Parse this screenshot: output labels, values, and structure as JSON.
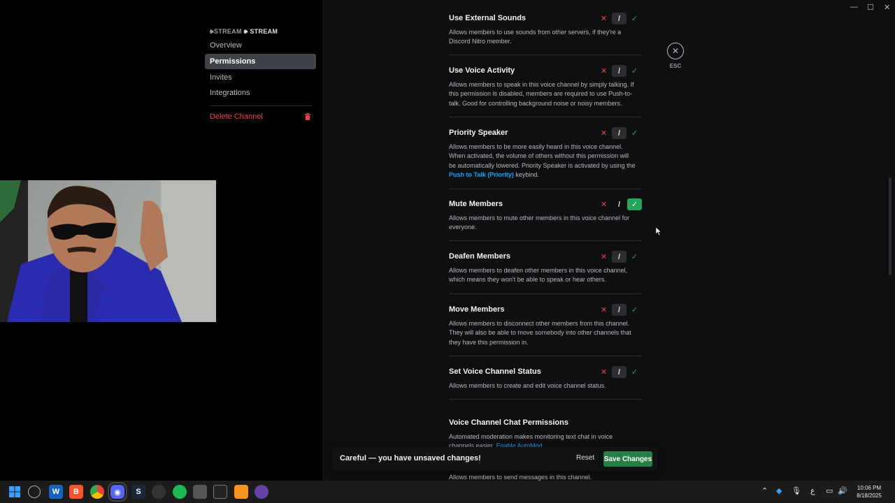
{
  "window": {
    "minimize_glyph": "—",
    "maximize_glyph": "☐",
    "close_glyph": "✕"
  },
  "sidebar": {
    "category_prefix": "🕪STREAM",
    "category_name": "🕪 STREAM",
    "items": [
      {
        "label": "Overview"
      },
      {
        "label": "Permissions"
      },
      {
        "label": "Invites"
      },
      {
        "label": "Integrations"
      }
    ],
    "delete_label": "Delete Channel"
  },
  "permissions": [
    {
      "title": "Use External Sounds",
      "desc": "Allows members to use sounds from other servers, if they're a Discord Nitro member.",
      "state": "neutral"
    },
    {
      "title": "Use Voice Activity",
      "desc": "Allows members to speak in this voice channel by simply talking. If this permission is disabled, members are required to use Push-to-talk. Good for controlling background noise or noisy members.",
      "state": "neutral"
    },
    {
      "title": "Priority Speaker",
      "desc_before": "Allows members to be more easily heard in this voice channel. When activated, the volume of others without this permission will be automatically lowered. Priority Speaker is activated by using the ",
      "desc_link": "Push to Talk (Priority)",
      "desc_after": " keybind.",
      "state": "neutral"
    },
    {
      "title": "Mute Members",
      "desc": "Allows members to mute other members in this voice channel for everyone.",
      "state": "allow"
    },
    {
      "title": "Deafen Members",
      "desc": "Allows members to deafen other members in this voice channel, which means they won't be able to speak or hear others.",
      "state": "neutral"
    },
    {
      "title": "Move Members",
      "desc": "Allows members to disconnect other members from this channel. They will also be able to move somebody into other channels that they have this permission in.",
      "state": "neutral"
    },
    {
      "title": "Set Voice Channel Status",
      "desc": "Allows members to create and edit voice channel status.",
      "state": "neutral"
    }
  ],
  "toggle_glyphs": {
    "deny": "✕",
    "neutral": "/",
    "allow": "✓"
  },
  "section": {
    "title": "Voice Channel Chat Permissions",
    "desc": "Automated moderation makes monitoring text chat in voice channels easier.",
    "link": "Enable AutoMod",
    "next_desc": "Allows members to send messages in this channel."
  },
  "close": {
    "glyph": "✕",
    "esc_label": "ESC"
  },
  "unsaved_bar": {
    "message": "Careful — you have unsaved changes!",
    "reset_label": "Reset",
    "save_label": "Save Changes"
  },
  "taskbar": {
    "time": "10:06 PM",
    "date": "8/18/2025",
    "tray_lang": "ع"
  },
  "colors": {
    "accent_green": "#23a55a",
    "deny_red": "#f23f43",
    "link_blue": "#00a8fc"
  }
}
